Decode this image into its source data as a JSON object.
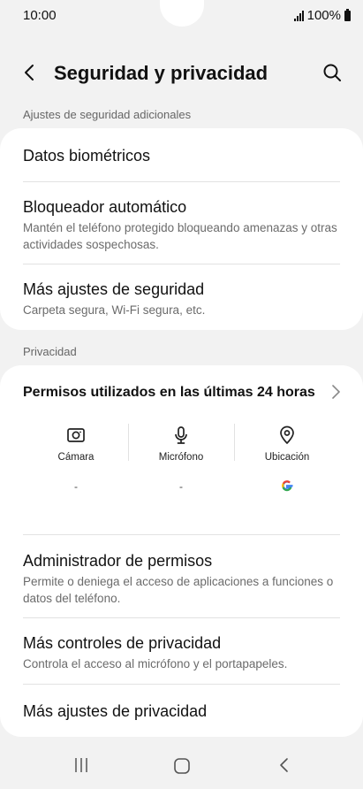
{
  "status": {
    "time": "10:00",
    "battery": "100%"
  },
  "header": {
    "title": "Seguridad y privacidad",
    "back_icon": "chevron-left-icon",
    "search_icon": "search-icon"
  },
  "security": {
    "section_label": "Ajustes de seguridad adicionales",
    "items": [
      {
        "title": "Datos biométricos",
        "subtitle": ""
      },
      {
        "title": "Bloqueador automático",
        "subtitle": "Mantén el teléfono protegido bloqueando amenazas y otras actividades sospechosas."
      },
      {
        "title": "Más ajustes de seguridad",
        "subtitle": "Carpeta segura, Wi-Fi segura, etc."
      }
    ]
  },
  "privacy": {
    "section_label": "Privacidad",
    "permissions_title": "Permisos utilizados en las últimas 24 horas",
    "permissions": [
      {
        "label": "Cámara",
        "value": "-",
        "icon": "camera-icon"
      },
      {
        "label": "Micrófono",
        "value": "-",
        "icon": "microphone-icon"
      },
      {
        "label": "Ubicación",
        "value": "",
        "icon": "location-icon",
        "app_icon": "google-icon"
      }
    ],
    "items": [
      {
        "title": "Administrador de permisos",
        "subtitle": "Permite o deniega el acceso de aplicaciones a funciones o datos del teléfono."
      },
      {
        "title": "Más controles de privacidad",
        "subtitle": "Controla el acceso al micrófono y el portapapeles."
      },
      {
        "title": "Más ajustes de privacidad",
        "subtitle": ""
      }
    ]
  },
  "navbar": {
    "recent_icon": "recent-apps-icon",
    "home_icon": "home-icon",
    "back_icon": "back-icon"
  }
}
